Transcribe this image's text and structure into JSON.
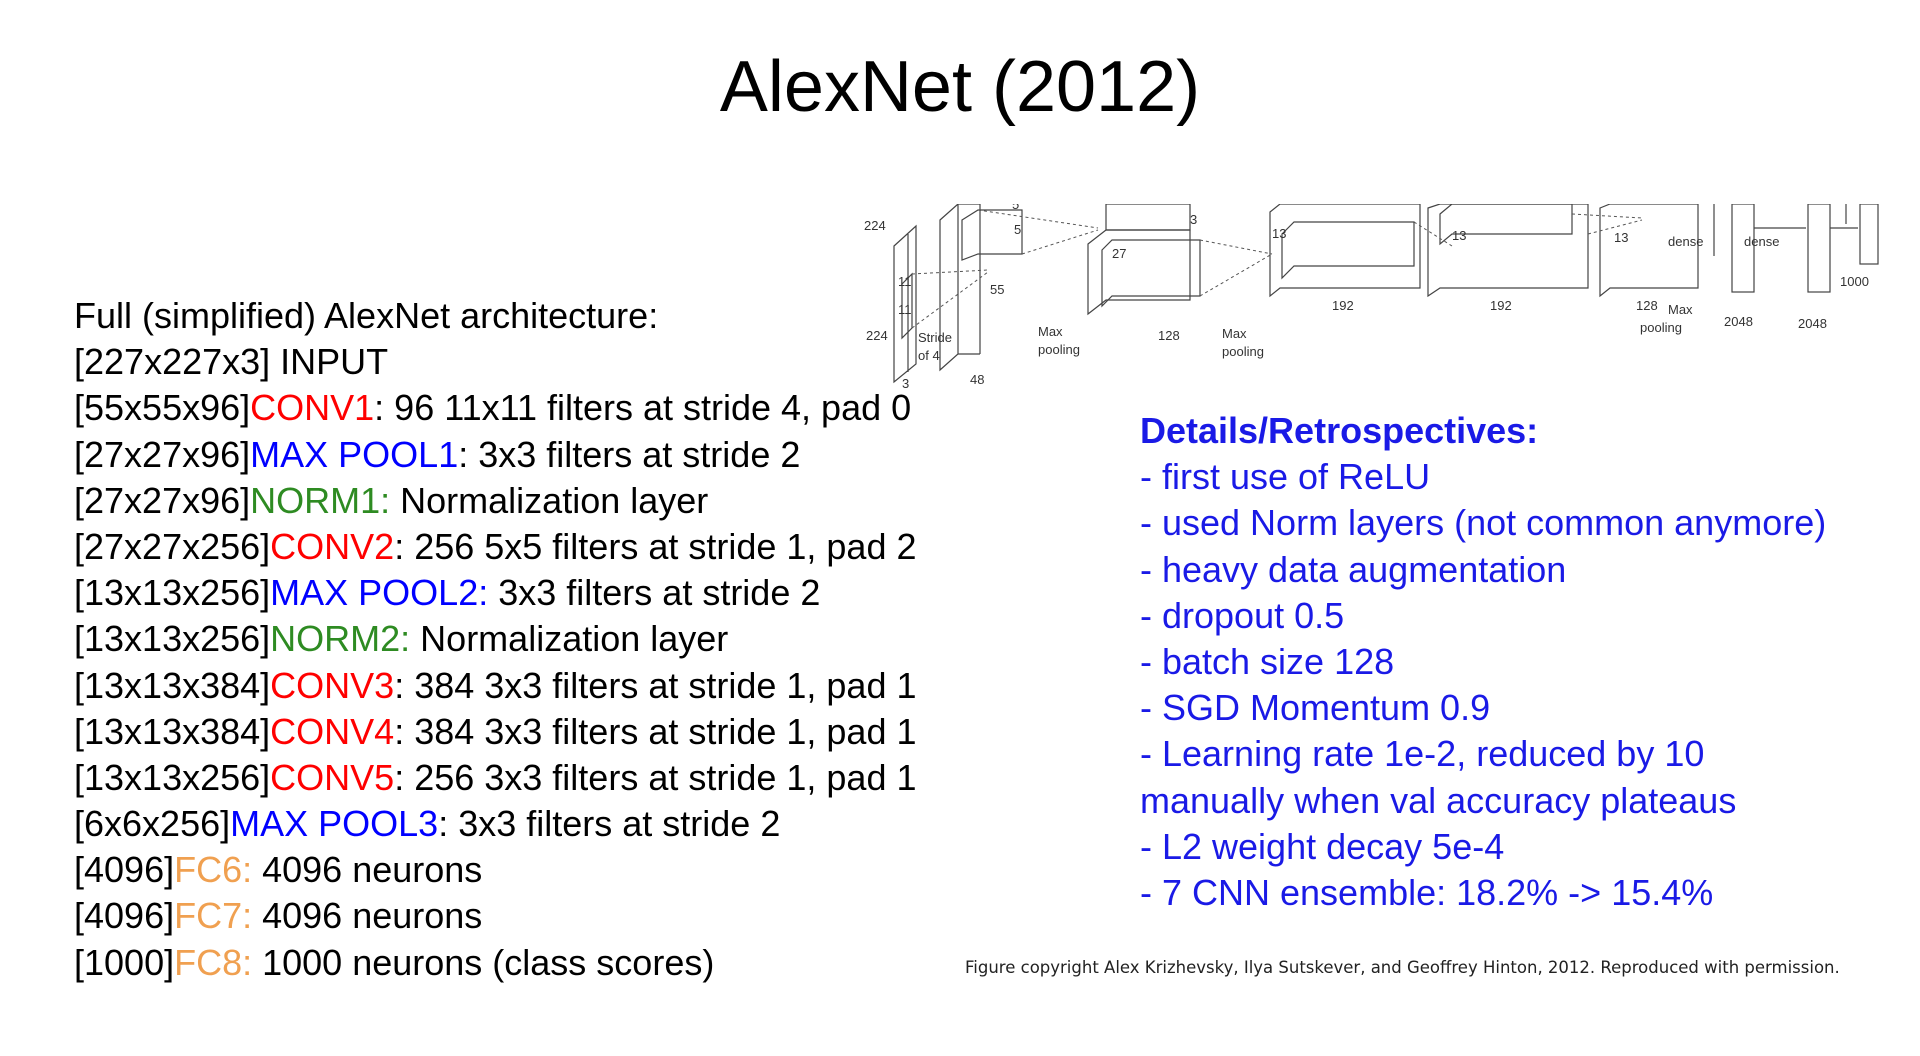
{
  "slide": {
    "title": "AlexNet (2012)"
  },
  "architecture": {
    "heading": "Full (simplified) AlexNet architecture:",
    "lines": [
      {
        "shape": "[227x227x3]",
        "layer": "",
        "type": "plain",
        "rest": " INPUT"
      },
      {
        "shape": "[55x55x96]",
        "layer": "CONV1",
        "type": "conv",
        "rest": ": 96 11x11 filters at stride 4, pad 0"
      },
      {
        "shape": "[27x27x96]",
        "layer": "MAX POOL1",
        "type": "pool",
        "rest": ": 3x3 filters at stride 2"
      },
      {
        "shape": "[27x27x96]",
        "layer": "NORM1:",
        "type": "norm",
        "rest": " Normalization layer"
      },
      {
        "shape": "[27x27x256]",
        "layer": "CONV2",
        "type": "conv",
        "rest": ": 256 5x5 filters at stride 1, pad 2"
      },
      {
        "shape": "[13x13x256]",
        "layer": "MAX POOL2:",
        "type": "pool",
        "rest": " 3x3 filters at stride 2"
      },
      {
        "shape": "[13x13x256]",
        "layer": "NORM2:",
        "type": "norm",
        "rest": " Normalization layer"
      },
      {
        "shape": "[13x13x384]",
        "layer": "CONV3",
        "type": "conv",
        "rest": ": 384 3x3 filters at stride 1, pad 1"
      },
      {
        "shape": "[13x13x384]",
        "layer": "CONV4",
        "type": "conv",
        "rest": ": 384 3x3 filters at stride 1, pad 1"
      },
      {
        "shape": "[13x13x256]",
        "layer": "CONV5",
        "type": "conv",
        "rest": ": 256 3x3 filters at stride 1, pad 1"
      },
      {
        "shape": "[6x6x256]",
        "layer": "MAX POOL3",
        "type": "pool",
        "rest": ": 3x3 filters at stride 2"
      },
      {
        "shape": "[4096]",
        "layer": "FC6:",
        "type": "fc",
        "rest": " 4096 neurons"
      },
      {
        "shape": "[4096]",
        "layer": "FC7:",
        "type": "fc",
        "rest": " 4096 neurons"
      },
      {
        "shape": "[1000]",
        "layer": "FC8:",
        "type": "fc",
        "rest": " 1000 neurons (class scores)"
      }
    ]
  },
  "details": {
    "heading": "Details/Retrospectives:",
    "items": [
      "- first use of ReLU",
      "- used Norm layers (not common anymore)",
      "- heavy data augmentation",
      "- dropout 0.5",
      "- batch size 128",
      "- SGD Momentum 0.9",
      "- Learning rate 1e-2, reduced by 10",
      "manually when val accuracy plateaus",
      "- L2 weight decay 5e-4",
      "- 7 CNN ensemble: 18.2% -> 15.4%"
    ]
  },
  "figure": {
    "labels": {
      "input_size": "224",
      "input_size_2": "224",
      "input_depth": "3",
      "kernel_11a": "11",
      "kernel_11b": "11",
      "stride_line1": "Stride",
      "stride_line2": "of 4",
      "conv1_size": "55",
      "conv1_depth": "48",
      "k5a": "5",
      "k5b": "5",
      "k3": "3",
      "k27": "27",
      "pool1_line1": "Max",
      "pool1_line2": "pooling",
      "conv2_depth": "128",
      "pool2_line1": "Max",
      "pool2_line2": "pooling",
      "k13a": "13",
      "k13b": "13",
      "k13c": "13",
      "conv3_depth": "192",
      "conv4_depth": "192",
      "conv5_depth": "128",
      "pool3_line1": "Max",
      "pool3_line2": "pooling",
      "dense1": "dense",
      "dense2": "dense",
      "fc6_size": "2048",
      "fc7_size": "2048",
      "fc8_size": "1000"
    }
  },
  "caption": "Figure copyright Alex Krizhevsky, Ilya Sutskever, and Geoffrey Hinton, 2012. Reproduced with permission."
}
